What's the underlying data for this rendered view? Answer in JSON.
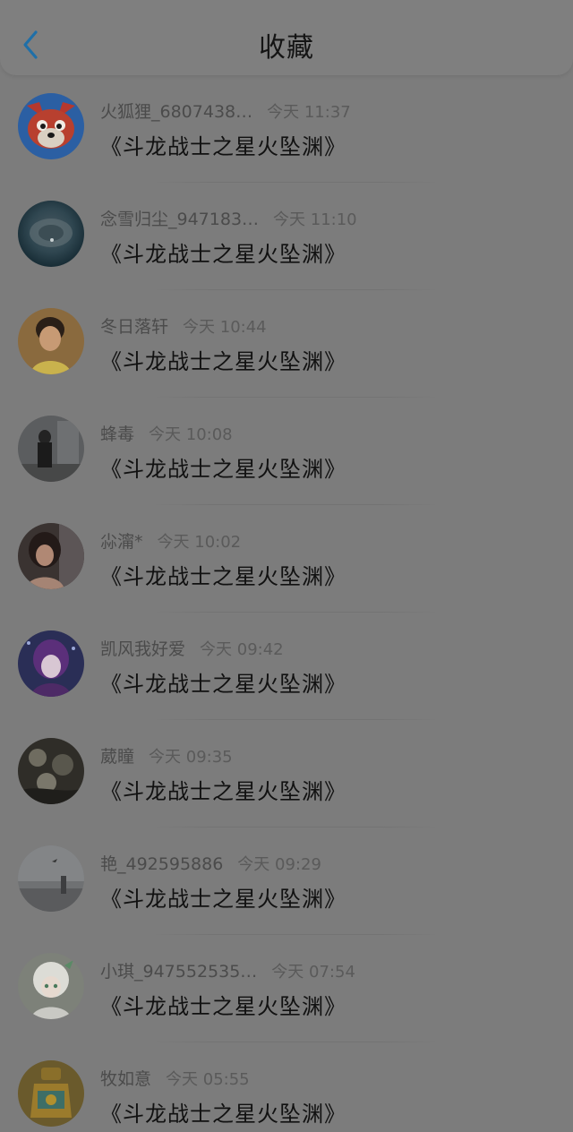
{
  "header": {
    "title": "收藏",
    "back_icon": "chevron-left-icon",
    "accent_color": "#1f6fa8"
  },
  "items": [
    {
      "user": "火狐狸_6807438…",
      "time": "今天 11:37",
      "title": "《斗龙战士之星火坠渊》",
      "avatar": "fox"
    },
    {
      "user": "念雪归尘_947183…",
      "time": "今天 11:10",
      "title": "《斗龙战士之星火坠渊》",
      "avatar": "cave"
    },
    {
      "user": "冬日落轩",
      "time": "今天 10:44",
      "title": "《斗龙战士之星火坠渊》",
      "avatar": "portrait-warm"
    },
    {
      "user": "蜂毒",
      "time": "今天 10:08",
      "title": "《斗龙战士之星火坠渊》",
      "avatar": "room"
    },
    {
      "user": "尛澝*",
      "time": "今天 10:02",
      "title": "《斗龙战士之星火坠渊》",
      "avatar": "girl-dark"
    },
    {
      "user": "凯风我好爱",
      "time": "今天 09:42",
      "title": "《斗龙战士之星火坠渊》",
      "avatar": "anime-purple"
    },
    {
      "user": "葳瞳",
      "time": "今天 09:35",
      "title": "《斗龙战士之星火坠渊》",
      "avatar": "flowers"
    },
    {
      "user": "艳_492595886",
      "time": "今天 09:29",
      "title": "《斗龙战士之星火坠渊》",
      "avatar": "sky"
    },
    {
      "user": "小琪_947552535…",
      "time": "今天 07:54",
      "title": "《斗龙战士之星火坠渊》",
      "avatar": "anime-white"
    },
    {
      "user": "牧如意",
      "time": "今天 05:55",
      "title": "《斗龙战士之星火坠渊》",
      "avatar": "gold-bottle"
    }
  ]
}
